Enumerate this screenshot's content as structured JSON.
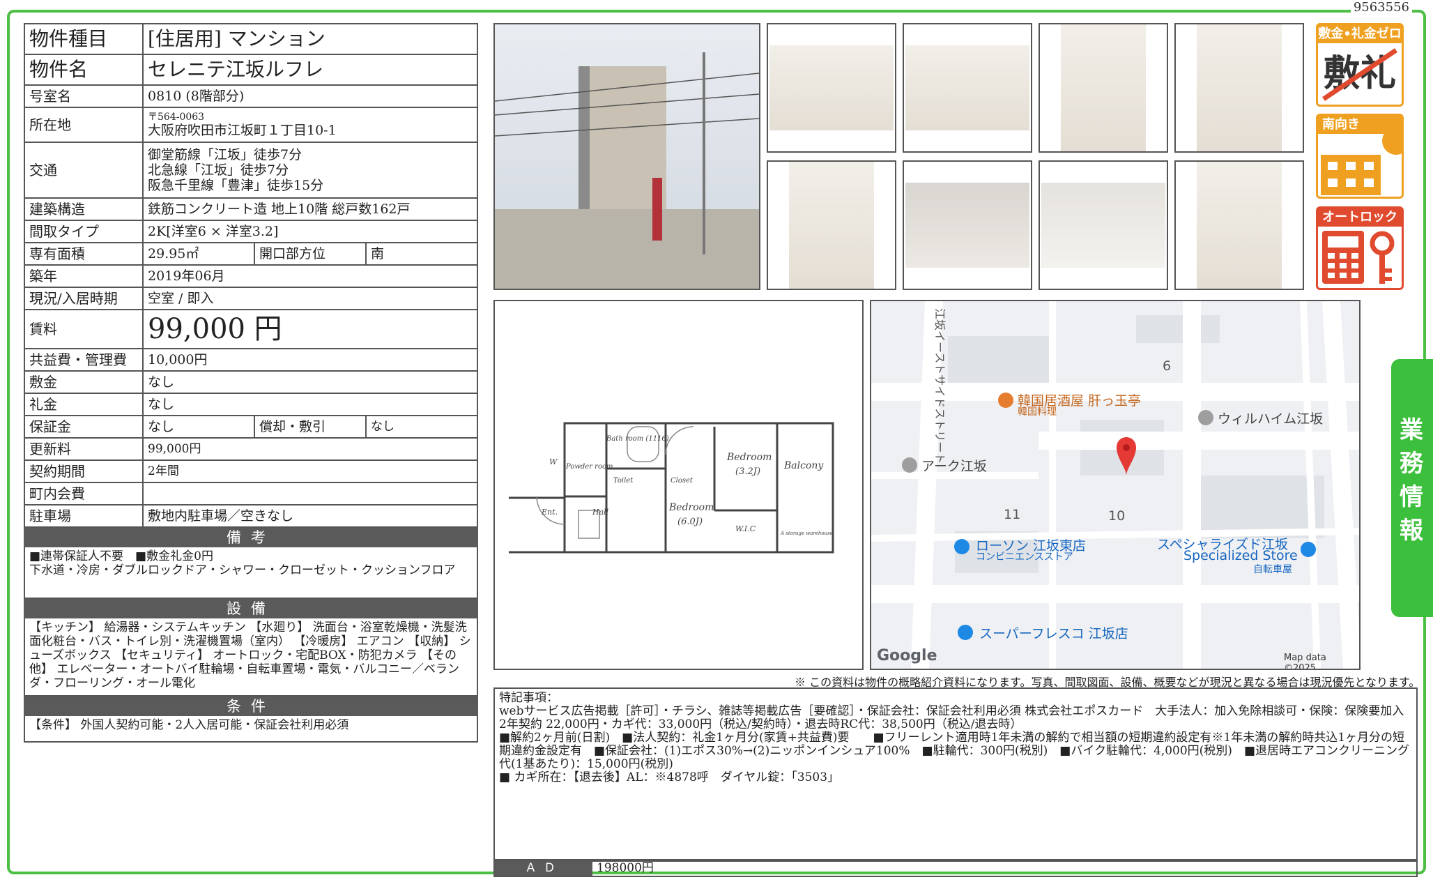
{
  "doc_id": "9563556",
  "spec": {
    "type_label": "物件種目",
    "type_value": "[住居用] マンション",
    "name_label": "物件名",
    "name_value": "セレニテ江坂ルフレ",
    "room_label": "号室名",
    "room_value": "0810 (8階部分)",
    "addr_label": "所在地",
    "addr_zip": "〒564-0063",
    "addr_value": "大阪府吹田市江坂町１丁目10-1",
    "access_label": "交通",
    "access_1": "御堂筋線「江坂」徒歩7分",
    "access_2": "北急線「江坂」徒歩7分",
    "access_3": "阪急千里線「豊津」徒歩15分",
    "structure_label": "建築構造",
    "structure_value": "鉄筋コンクリート造 地上10階 総戸数162戸",
    "layout_label": "間取タイプ",
    "layout_value": "2K[洋室6 × 洋室3.2]",
    "area_label": "専有面積",
    "area_value": "29.95㎡",
    "facing_label": "開口部方位",
    "facing_value": "南",
    "built_label": "築年",
    "built_value": "2019年06月",
    "status_label": "現況/入居時期",
    "status_value": "空室 / 即入",
    "rent_label": "賃料",
    "rent_value": "99,000 円",
    "fee_label": "共益費・管理費",
    "fee_value": "10,000円",
    "deposit_label": "敷金",
    "deposit_value": "なし",
    "key_label": "礼金",
    "key_value": "なし",
    "guarantee_label": "保証金",
    "guarantee_value": "なし",
    "amort_label": "償却・敷引",
    "amort_value": "なし",
    "renew_label": "更新料",
    "renew_value": "99,000円",
    "term_label": "契約期間",
    "term_value": "2年間",
    "town_label": "町内会費",
    "town_value": "",
    "parking_label": "駐車場",
    "parking_value": "敷地内駐車場／空きなし"
  },
  "bikou": {
    "header": "備考",
    "line1": "■連帯保証人不要　■敷金礼金0円",
    "line2": "下水道・冷房・ダブルロックドア・シャワー・クローゼット・クッションフロア"
  },
  "setsubi": {
    "header": "設備",
    "text": "【キッチン】 給湯器・システムキッチン 【水廻り】 洗面台・浴室乾燥機・洗髪洗面化粧台・バス・トイレ別・洗濯機置場（室内） 【冷暖房】 エアコン 【収納】 シューズボックス 【セキュリティ】 オートロック・宅配BOX・防犯カメラ 【その他】 エレベーター・オートバイ駐輪場・自転車置場・電気・バルコニー／ベランダ・フローリング・オール電化"
  },
  "joken": {
    "header": "条件",
    "text": "【条件】 外国人契約可能・2人入居可能・保証会社利用必須"
  },
  "badges": {
    "b1": "敷金•礼金ゼロ",
    "b1_mark1": "敷",
    "b1_mark2": "礼",
    "b2": "南向き",
    "b3": "オートロック"
  },
  "plan_labels": {
    "bath": "Bath room (1116)",
    "powder": "Powder room",
    "toilet": "Toilet",
    "closet": "Closet",
    "bed1": "Bedroom",
    "bed1_size": "(3.2J)",
    "balcony": "Balcony",
    "bed2": "Bedroom",
    "bed2_size": "(6.0J)",
    "ent": "Ent.",
    "hall": "Hall",
    "wic": "W.I.C",
    "w": "W",
    "storage": "A storage warehouse"
  },
  "map": {
    "road": "江坂イーストサイドストリート",
    "block6": "6",
    "block11": "11",
    "block10": "10",
    "place1": "韓国居酒屋 肝っ玉亭",
    "place1_sub": "韓国料理",
    "place2": "ウィルハイム江坂",
    "place3": "アーク江坂",
    "place4": "ローソン 江坂東店",
    "place4_sub": "コンビニエンスストア",
    "place5": "スペシャライズド江坂",
    "place5_sub": "Specialized Store",
    "place5_sub2": "自転車屋",
    "place6": "スーパーフレスコ 江坂店",
    "google": "Google",
    "mapdata": "Map data ©2025"
  },
  "note": "※ この資料は物件の概略紹介資料になります。写真、間取図面、設備、概要などが現況と異なる場合は現況優先となります。",
  "remarks": {
    "title": "特記事項：",
    "l1": "webサービス広告掲載［許可］・チラシ、雑誌等掲載広告［要確認］・保証会社：保証会社利用必須 株式会社エポスカード　大手法人：加入免除相談可・保険：保険要加入 2年契約 22,000円・カギ代：33,000円（税込/契約時）・退去時RC代：38,500円（税込/退去時）",
    "l2": "■解約2ヶ月前(日割)　■法人契約：礼金1ヶ月分(家賃+共益費)要　　■フリーレント適用時1年未満の解約で相当額の短期違約設定有※1年未満の解約時共込1ヶ月分の短期違約金設定有　■保証会社：(1)エポス30%→(2)ニッポンインシュア100%　■駐輪代：300円(税別)　■バイク駐輪代：4,000円(税別)　■退居時エアコンクリーニング代(1基あたり)：15,000円(税別)",
    "l3": "■ カギ所在：【退去後】AL：※4878呼　ダイヤル錠：「3503」"
  },
  "ad": {
    "label": "ＡＤ",
    "value": "198000円"
  },
  "side_tab": "業務情報"
}
